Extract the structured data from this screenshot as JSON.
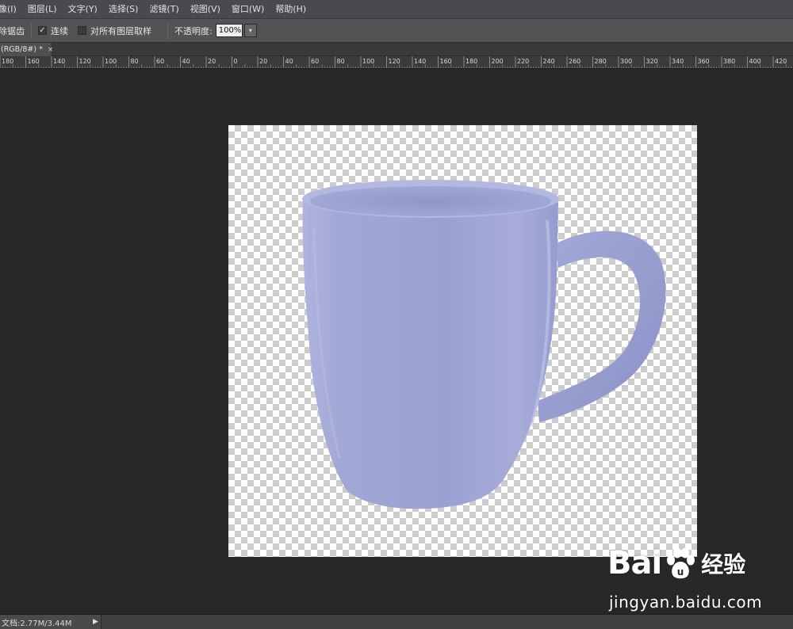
{
  "menu": {
    "items": [
      "像(I)",
      "图层(L)",
      "文字(Y)",
      "选择(S)",
      "滤镜(T)",
      "视图(V)",
      "窗口(W)",
      "帮助(H)"
    ]
  },
  "options": {
    "antialias_label": "除锯齿",
    "contiguous_label": "连续",
    "contiguous_checked": true,
    "sample_all_label": "对所有图层取样",
    "sample_all_checked": false,
    "opacity_label": "不透明度:",
    "opacity_value": "100%"
  },
  "document_tab": {
    "title": "(RGB/8#) *",
    "close_glyph": "×"
  },
  "ruler": {
    "labels": [
      "180",
      "160",
      "140",
      "120",
      "100",
      "80",
      "60",
      "40",
      "20",
      "0",
      "20",
      "40",
      "60",
      "80",
      "100",
      "120",
      "140",
      "160",
      "180",
      "200",
      "220",
      "240",
      "260",
      "280",
      "300",
      "320",
      "340",
      "360",
      "380",
      "400",
      "420"
    ]
  },
  "canvas": {
    "mug_color": "#a3a9d6",
    "checker_color": "#cccccc"
  },
  "watermark": {
    "brand_latin": "Bai",
    "brand_latin_end": "u",
    "brand_cn": "经验",
    "url": "jingyan.baidu.com"
  },
  "status": {
    "doc_info": "文档:2.77M/3.44M",
    "arrow_icon": "triangle-right-icon"
  }
}
